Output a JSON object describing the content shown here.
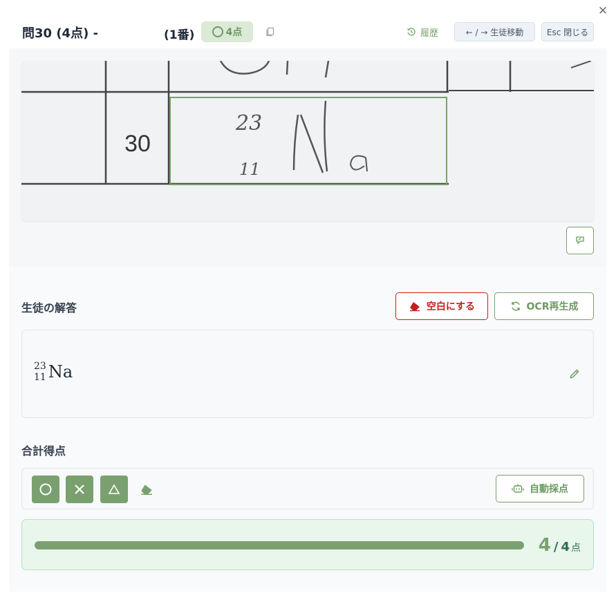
{
  "header": {
    "title": "問30 (4点) -",
    "title_suffix": "(1番)",
    "score_badge": "4点",
    "history_label": "履歴",
    "nav_hint": "← / → 生徒移動",
    "close_label": "Esc 閉じる"
  },
  "scan": {
    "question_number": "30",
    "handwriting_mass": "23",
    "handwriting_atomic": "11",
    "handwriting_symbol": "Na"
  },
  "student_answer": {
    "label": "生徒の解答",
    "blank_button": "空白にする",
    "ocr_button": "OCR再生成",
    "mass_number": "23",
    "atomic_number": "11",
    "symbol": "Na"
  },
  "grading": {
    "label": "合計得点",
    "auto_button": "自動採点",
    "score": "4",
    "max": "4",
    "unit": "点",
    "progress_fraction": 1.0
  },
  "colors": {
    "accent": "#7aa06f",
    "danger": "#c81e1e",
    "success_bg": "#e8f6ec"
  },
  "icons": {
    "close": "close-icon",
    "copy": "copy-icon",
    "history": "history-icon",
    "image_edit": "annotate-icon",
    "eraser": "eraser-icon",
    "refresh": "refresh-icon",
    "pencil": "pencil-icon",
    "robot": "robot-icon"
  }
}
